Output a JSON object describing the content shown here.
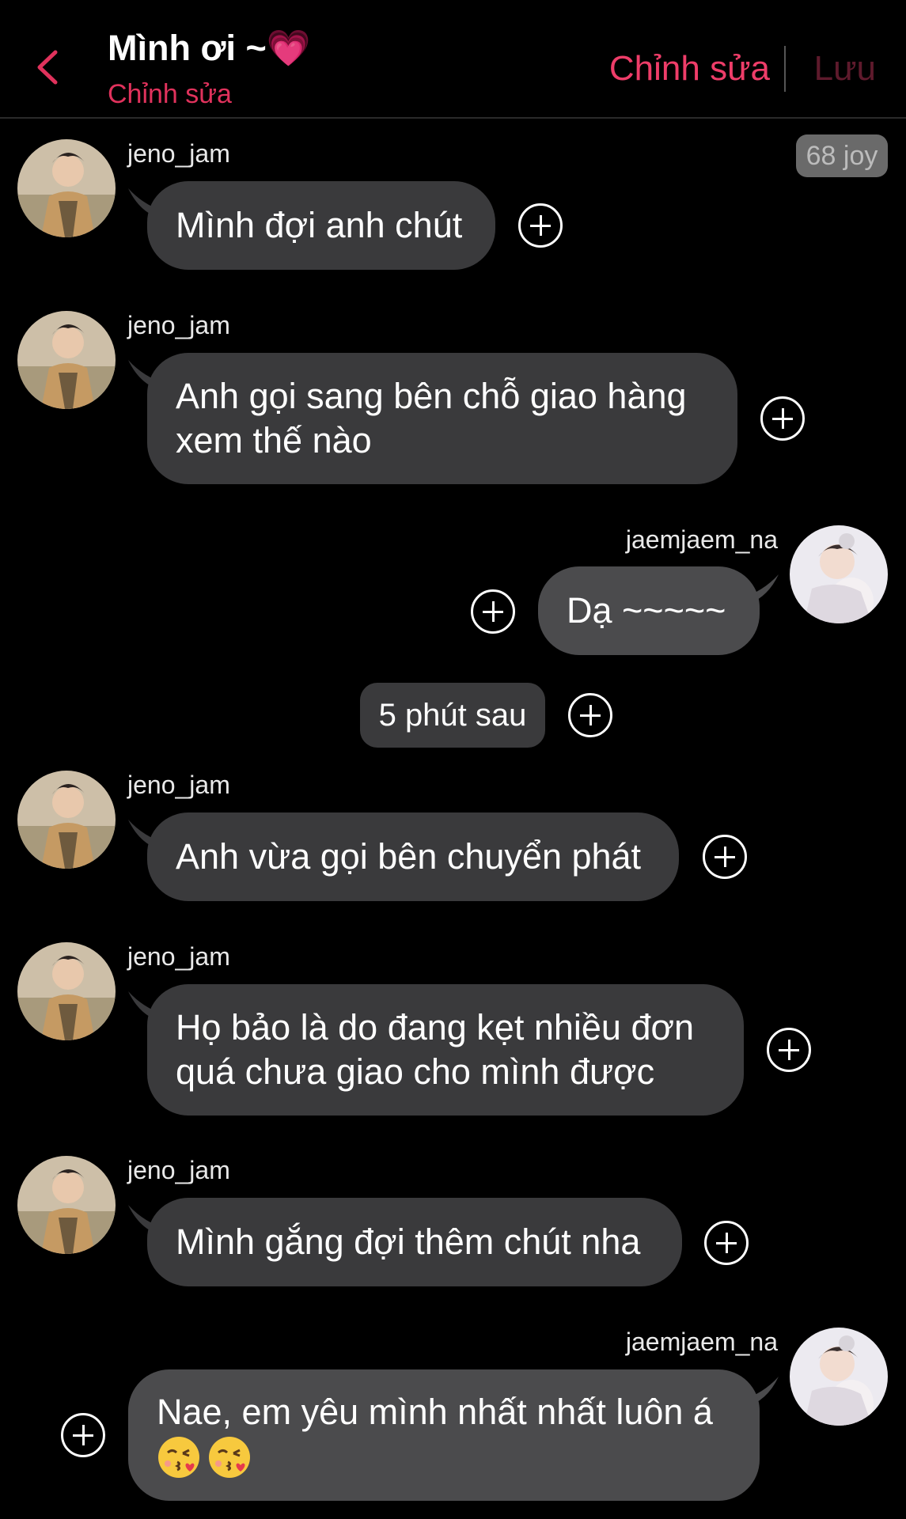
{
  "header": {
    "title": "Mình ơi ~💗",
    "subtitle": "Chỉnh sửa",
    "edit_label": "Chỉnh sửa",
    "save_label": "Lưu",
    "accent_color": "#ee3d69"
  },
  "joy_badge": "68 joy",
  "messages": [
    {
      "sender": "jeno_jam",
      "side": "left",
      "text": "Mình đợi anh chút"
    },
    {
      "sender": "jeno_jam",
      "side": "left",
      "text": "Anh gọi sang bên chỗ giao hàng\nxem thế nào"
    },
    {
      "sender": "jaemjaem_na",
      "side": "right",
      "text": "Dạ ~~~~~"
    },
    {
      "sender": "jeno_jam",
      "side": "left",
      "text": "Anh vừa gọi bên chuyển phát"
    },
    {
      "sender": "jeno_jam",
      "side": "left",
      "text": "Họ bảo là do đang kẹt nhiều đơn\nquá chưa giao cho mình được"
    },
    {
      "sender": "jeno_jam",
      "side": "left",
      "text": "Mình gắng đợi thêm chút nha"
    },
    {
      "sender": "jaemjaem_na",
      "side": "right",
      "text": "Nae, em yêu mình nhất nhất luôn á"
    }
  ],
  "time_separator": "5 phút sau",
  "emojis": [
    "😘",
    "😘"
  ],
  "icons": [
    "back-chevron-icon",
    "add-circle-icon",
    "kissing-face-icon"
  ]
}
